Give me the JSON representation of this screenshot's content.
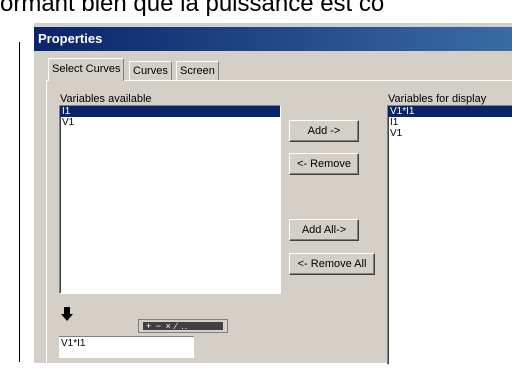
{
  "background_text": "ormant bien que la puissance est co",
  "window": {
    "title": "Properties"
  },
  "tabs": [
    {
      "label": "Select Curves",
      "active": true
    },
    {
      "label": "Curves",
      "active": false
    },
    {
      "label": "Screen",
      "active": false
    }
  ],
  "available": {
    "label": "Variables available",
    "items": [
      {
        "label": "I1",
        "selected": true
      },
      {
        "label": "V1",
        "selected": false
      }
    ]
  },
  "display": {
    "label": "Variables for display",
    "items": [
      {
        "label": "V1*I1",
        "selected": true
      },
      {
        "label": "I1",
        "selected": false
      },
      {
        "label": "V1",
        "selected": false
      }
    ]
  },
  "buttons": {
    "add": "Add ->",
    "remove": "<- Remove",
    "add_all": "Add All->",
    "remove_all": "<- Remove All"
  },
  "operators": "+ − × ∕ ..",
  "expression": "V1*I1"
}
